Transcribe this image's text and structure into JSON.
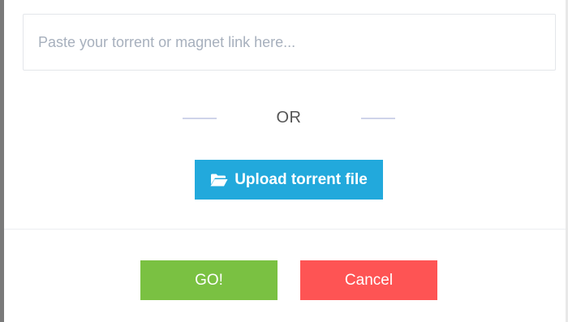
{
  "link_input": {
    "value": "",
    "placeholder": "Paste your torrent or magnet link here..."
  },
  "separator": {
    "label": "OR"
  },
  "upload": {
    "label": "Upload torrent file",
    "icon": "folder-open-icon",
    "color": "#22a9dc"
  },
  "footer": {
    "go_label": "GO!",
    "go_color": "#7ac142",
    "cancel_label": "Cancel",
    "cancel_color": "#fe5454"
  }
}
